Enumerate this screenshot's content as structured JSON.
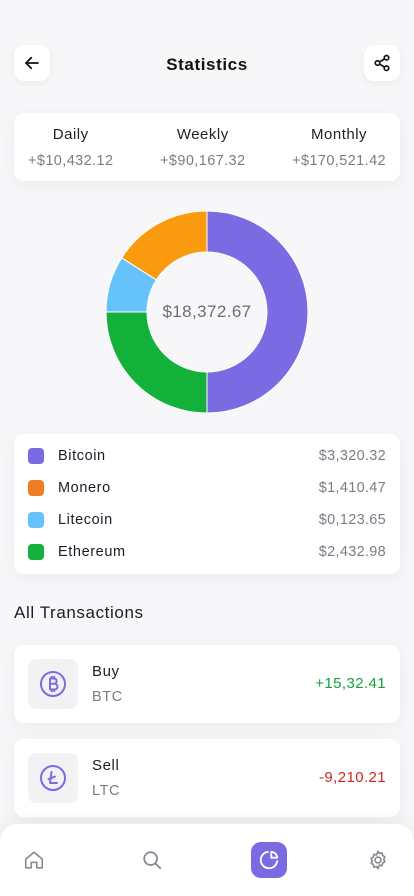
{
  "header": {
    "title": "Statistics"
  },
  "summary": [
    {
      "label": "Daily",
      "value": "+$10,432.12"
    },
    {
      "label": "Weekly",
      "value": "+$90,167.32"
    },
    {
      "label": "Monthly",
      "value": "+$170,521.42"
    }
  ],
  "chart_data": {
    "type": "pie",
    "title": "",
    "center_label": "$18,372.67",
    "categories": [
      "Bitcoin",
      "Ethereum",
      "Litecoin",
      "Monero"
    ],
    "values": [
      50,
      25,
      9,
      16
    ],
    "colors": [
      "#7b6be3",
      "#13b13a",
      "#66c2fb",
      "#f99a0f"
    ],
    "donut": true
  },
  "legend": [
    {
      "name": "Bitcoin",
      "value": "$3,320.32",
      "color": "#7b6be3"
    },
    {
      "name": "Monero",
      "value": "$1,410.47",
      "color": "#f07c23"
    },
    {
      "name": "Litecoin",
      "value": "$0,123.65",
      "color": "#66c2fb"
    },
    {
      "name": "Ethereum",
      "value": "$2,432.98",
      "color": "#13b13a"
    }
  ],
  "transactions": {
    "title": "All Transactions",
    "items": [
      {
        "type": "Buy",
        "symbol": "BTC",
        "amount": "+15,32.41",
        "amount_color": "#13a13a",
        "icon": "bitcoin-icon"
      },
      {
        "type": "Sell",
        "symbol": "LTC",
        "amount": "-9,210.21",
        "amount_color": "#d02424",
        "icon": "litecoin-icon"
      }
    ]
  },
  "nav": {
    "items": [
      {
        "name": "home",
        "icon": "home-icon"
      },
      {
        "name": "search",
        "icon": "search-icon"
      },
      {
        "name": "statistics",
        "icon": "pie-chart-icon",
        "active": true
      },
      {
        "name": "settings",
        "icon": "gear-icon"
      }
    ]
  },
  "colors": {
    "accent": "#7b6be3",
    "positive": "#13a13a",
    "negative": "#d02424"
  }
}
